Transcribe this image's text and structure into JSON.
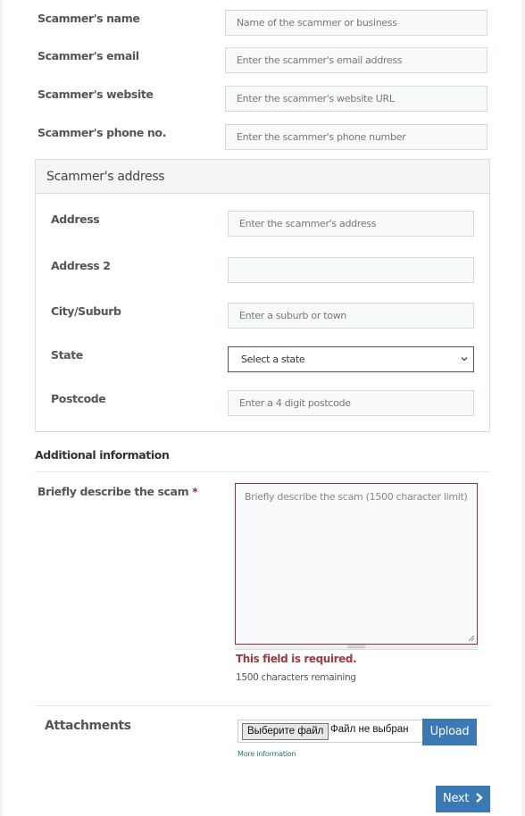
{
  "scammer_details": {
    "fields": [
      {
        "label": "Scammer's name",
        "placeholder": "Name of the scammer or business",
        "value": ""
      },
      {
        "label": "Scammer's email",
        "placeholder": "Enter the scammer's email address",
        "value": ""
      },
      {
        "label": "Scammer's website",
        "placeholder": "Enter the scammer's website URL",
        "value": ""
      },
      {
        "label": "Scammer's phone no.",
        "placeholder": "Enter the scammer's phone number",
        "value": ""
      }
    ]
  },
  "address_panel": {
    "title": "Scammer's address",
    "fields": [
      {
        "label": "Address",
        "placeholder": "Enter the scammer's address",
        "value": ""
      },
      {
        "label": "Address 2",
        "placeholder": "",
        "value": ""
      },
      {
        "label": "City/Suburb",
        "placeholder": "Enter a suburb or town",
        "value": ""
      }
    ],
    "state": {
      "label": "State",
      "selected": "Select a state"
    },
    "postcode": {
      "label": "Postcode",
      "placeholder": "Enter a 4 digit postcode",
      "value": ""
    }
  },
  "additional": {
    "title": "Additional information",
    "describe": {
      "label": "Briefly describe the scam",
      "required_marker": "*",
      "placeholder": "Briefly describe the scam (1500 character limit)",
      "value": "",
      "error": "This field is required.",
      "remaining": "1500 characters remaining"
    }
  },
  "attachments": {
    "label": "Attachments",
    "choose_button": "Выберите файл",
    "file_status": "Файл не выбран",
    "upload_button": "Upload",
    "more_info_link": "More information"
  },
  "footer": {
    "next_button": "Next"
  },
  "colors": {
    "primary": "#3a79b3",
    "error": "#9b3a42"
  }
}
